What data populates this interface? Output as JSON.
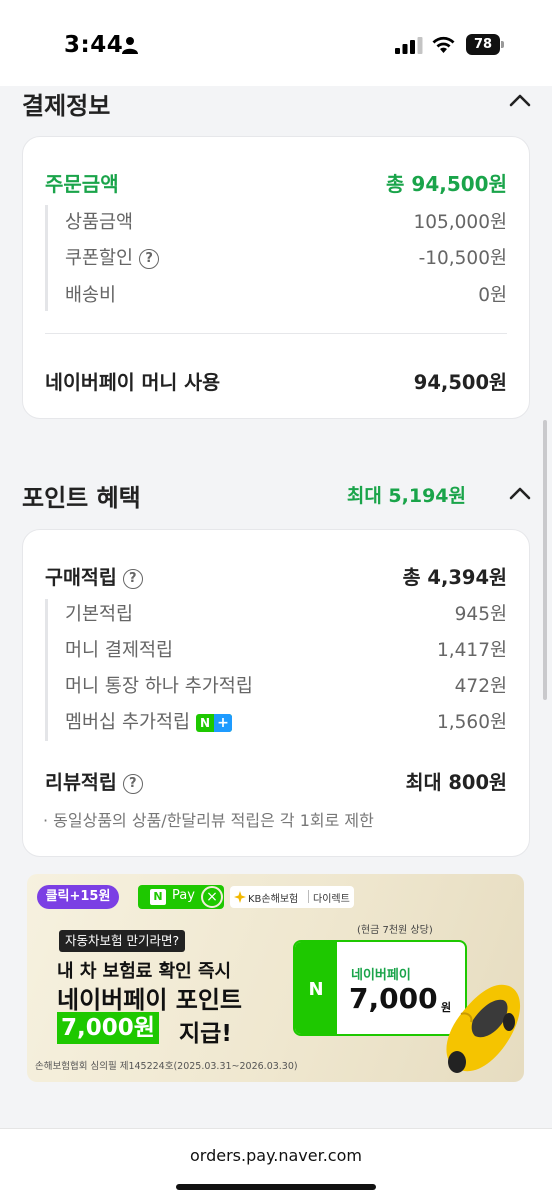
{
  "status_bar": {
    "time": "3:44",
    "battery": "78"
  },
  "payment_info": {
    "title": "결제정보",
    "order_amount_label": "주문금액",
    "order_amount_value": "총 94,500원",
    "items": [
      {
        "label": "상품금액",
        "value": "105,000원"
      },
      {
        "label": "쿠폰할인",
        "value": "-10,500원",
        "help": "?"
      },
      {
        "label": "배송비",
        "value": "0원"
      }
    ],
    "money_label": "네이버페이 머니 사용",
    "money_value": "94,500원"
  },
  "points": {
    "title": "포인트 혜택",
    "max": "최대 5,194원",
    "purchase_label": "구매적립",
    "purchase_value": "총 4,394원",
    "purchase_items": [
      {
        "label": "기본적립",
        "value": "945원"
      },
      {
        "label": "머니 결제적립",
        "value": "1,417원"
      },
      {
        "label": "머니 통장 하나 추가적립",
        "value": "472원"
      },
      {
        "label": "멤버십 추가적립",
        "value": "1,560원",
        "badge_n": "N",
        "badge_plus": "+"
      }
    ],
    "review_label": "리뷰적립",
    "review_value": "최대 800원",
    "note": "· 동일상품의 상품/한달리뷰 적립은 각 1회로 제한"
  },
  "ad": {
    "click_badge": "클릭+15원",
    "pay_n": "N",
    "pay_label": "Pay",
    "close_x": "×",
    "kb_label": "KB손해보험",
    "direct_label": "다이렉트",
    "tag": "자동차보험 만기라면?",
    "line1": "내 차 보험료 확인 즉시",
    "line2": "네이버페이 포인트",
    "line3_highlight": "7,000원",
    "line3_rest": "지급!",
    "footer": "손해보험협회 심의필 제145224호(2025.03.31~2026.03.30)",
    "card_note": "(현금 7천원 상당)",
    "card_n": "N",
    "card_brand": "네이버페이",
    "card_amount": "7,000",
    "card_unit": "원"
  },
  "browser": {
    "url": "orders.pay.naver.com"
  },
  "colors": {
    "green": "#1aa44a",
    "naver_green": "#1ec800",
    "ad_purple": "#7b3fe4"
  }
}
